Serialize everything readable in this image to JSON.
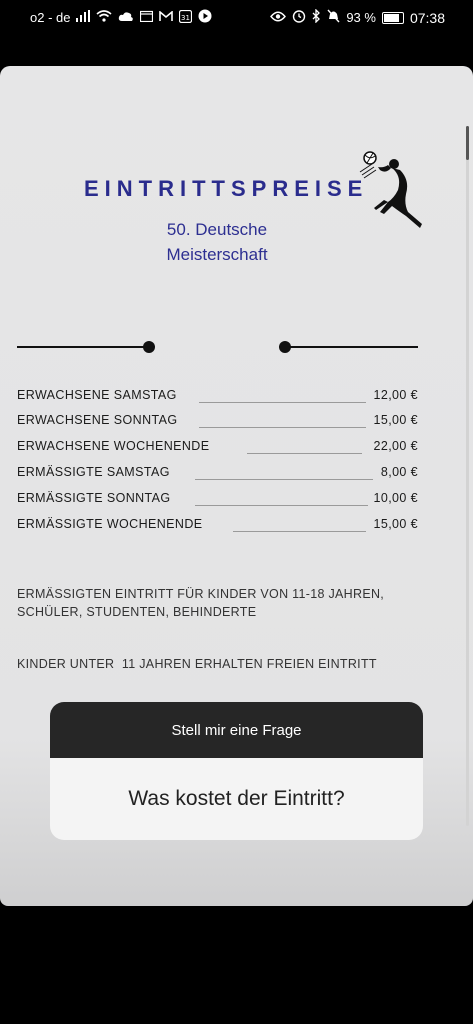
{
  "status_bar": {
    "carrier": "o2 - de",
    "battery_percent": "93 %",
    "time": "07:38",
    "left_icons": [
      "signal-icon",
      "wifi-icon",
      "cloud-icon",
      "calendar-icon",
      "gmail-icon",
      "calendar-31-icon",
      "play-icon"
    ],
    "right_icons": [
      "eye-icon",
      "alarm-icon",
      "bluetooth-icon",
      "mute-icon",
      "battery-icon"
    ]
  },
  "story": {
    "title": "EINTRITTSPREISE",
    "subtitle_line1": "50. Deutsche",
    "subtitle_line2": "Meisterschaft",
    "prices": [
      {
        "label": "ERWACHSENE SAMSTAG",
        "value": "12,00 €"
      },
      {
        "label": "ERWACHSENE SONNTAG",
        "value": "15,00 €"
      },
      {
        "label": "ERWACHSENE WOCHENENDE",
        "value": "22,00 €"
      },
      {
        "label": "ERMÄSSIGTE SAMSTAG",
        "value": "8,00 €"
      },
      {
        "label": "ERMÄSSIGTE SONNTAG",
        "value": "10,00 €"
      },
      {
        "label": "ERMÄSSIGTE WOCHENENDE",
        "value": "15,00 €"
      }
    ],
    "info_line1": "ERMÄSSIGTEN EINTRITT FÜR KINDER VON 11-18 JAHREN,",
    "info_line2": "SCHÜLER, STUDENTEN, BEHINDERTE",
    "info_line3": "KINDER UNTER  11 JAHREN ERHALTEN FREIEN EINTRITT"
  },
  "question_sticker": {
    "header": "Stell mir eine Frage",
    "question": "Was kostet der Eintritt?"
  },
  "colors": {
    "title_blue": "#2a2c8d",
    "card_background": "#e6e6e7",
    "sticker_header": "#262626"
  }
}
